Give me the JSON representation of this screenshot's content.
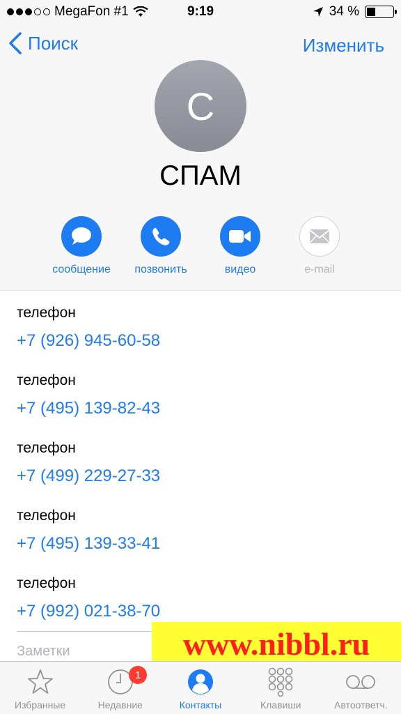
{
  "status_bar": {
    "carrier": "MegaFon #1",
    "time": "9:19",
    "battery_percent": "34 %",
    "battery_level": 0.34,
    "signal_bars_filled": 3,
    "signal_bars_total": 5
  },
  "nav": {
    "back_label": "Поиск",
    "edit_label": "Изменить"
  },
  "contact": {
    "initial": "С",
    "name": "СПАМ"
  },
  "actions": [
    {
      "label": "сообщение",
      "icon": "message-icon",
      "enabled": true
    },
    {
      "label": "позвонить",
      "icon": "phone-icon",
      "enabled": true
    },
    {
      "label": "видео",
      "icon": "video-icon",
      "enabled": true
    },
    {
      "label": "e-mail",
      "icon": "mail-icon",
      "enabled": false
    }
  ],
  "phones": [
    {
      "label": "телефон",
      "number": "+7 (926) 945-60-58"
    },
    {
      "label": "телефон",
      "number": "+7 (495) 139-82-43"
    },
    {
      "label": "телефон",
      "number": "+7 (499) 229-27-33"
    },
    {
      "label": "телефон",
      "number": "+7 (495) 139-33-41"
    },
    {
      "label": "телефон",
      "number": "+7 (992) 021-38-70"
    }
  ],
  "notes_label": "Заметки",
  "watermark": "www.nibbl.ru",
  "tabs": [
    {
      "label": "Избранные",
      "icon": "star-icon",
      "active": false
    },
    {
      "label": "Недавние",
      "icon": "clock-icon",
      "active": false,
      "badge": "1"
    },
    {
      "label": "Контакты",
      "icon": "contacts-icon",
      "active": true
    },
    {
      "label": "Клавиши",
      "icon": "keypad-icon",
      "active": false
    },
    {
      "label": "Автоответч.",
      "icon": "voicemail-icon",
      "active": false
    }
  ],
  "colors": {
    "accent": "#1e7cf2",
    "badge": "#fe3b30",
    "watermark_bg": "#ffff33",
    "watermark_text": "#ff1e1e"
  }
}
